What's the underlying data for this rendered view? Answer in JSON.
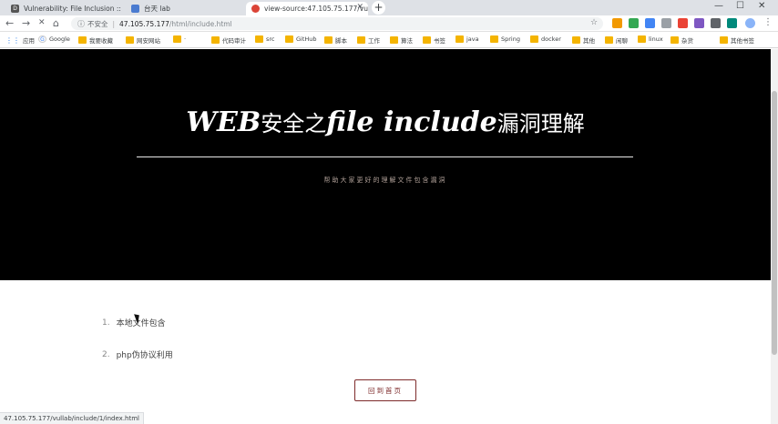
{
  "browser": {
    "tabs": [
      {
        "title": "Vulnerability: File Inclusion :: D",
        "active": false,
        "favicon_color": "#555555",
        "favicon_glyph": "D"
      },
      {
        "title": "台天 lab",
        "active": false,
        "favicon_color": "#4a7bd0",
        "favicon_glyph": ""
      },
      {
        "title": "view-source:47.105.75.177/vu",
        "active": true,
        "favicon_color": "#db4437",
        "favicon_glyph": ""
      }
    ],
    "new_tab_glyph": "+",
    "window_controls": [
      "—",
      "☐",
      "✕"
    ],
    "nav": {
      "back": "←",
      "forward": "→",
      "stop": "✕",
      "home": "⌂"
    },
    "address": {
      "insecure_label": "不安全",
      "host": "47.105.75.177",
      "path": "/html/include.html"
    },
    "bookmarks": [
      {
        "label": "应用",
        "icon": "apps-icon"
      },
      {
        "label": "Google",
        "icon": "google-icon"
      },
      {
        "label": "我要收藏",
        "icon": "folder-icon"
      },
      {
        "label": "网安网站",
        "icon": "folder-icon"
      },
      {
        "label": "·",
        "icon": "folder-icon"
      },
      {
        "label": "代码审计",
        "icon": "folder-icon"
      },
      {
        "label": "src",
        "icon": "folder-icon"
      },
      {
        "label": "GitHub",
        "icon": "folder-icon"
      },
      {
        "label": "脚本",
        "icon": "folder-icon"
      },
      {
        "label": "工作",
        "icon": "folder-icon"
      },
      {
        "label": "算法",
        "icon": "folder-icon"
      },
      {
        "label": "书签",
        "icon": "folder-icon"
      },
      {
        "label": "java",
        "icon": "folder-icon"
      },
      {
        "label": "Spring",
        "icon": "folder-icon"
      },
      {
        "label": "docker",
        "icon": "folder-icon"
      },
      {
        "label": "其他",
        "icon": "folder-icon"
      },
      {
        "label": "闲聊",
        "icon": "folder-icon"
      },
      {
        "label": "linux",
        "icon": "folder-icon"
      },
      {
        "label": "杂货",
        "icon": "folder-icon"
      },
      {
        "label": "其他书签",
        "icon": "folder-icon"
      }
    ],
    "status_url": "47.105.75.177/vullab/include/1/index.html"
  },
  "page": {
    "hero": {
      "title_latin_1": "WEB",
      "title_cjk_1": "安全之",
      "title_latin_2": "file include",
      "title_cjk_2": "漏洞理解",
      "subtitle": "帮助大家更好的理解文件包含漏洞"
    },
    "list": [
      {
        "num": "1.",
        "label": "本地文件包含"
      },
      {
        "num": "2.",
        "label": "php伪协议利用"
      }
    ],
    "home_button": "回到首页"
  }
}
